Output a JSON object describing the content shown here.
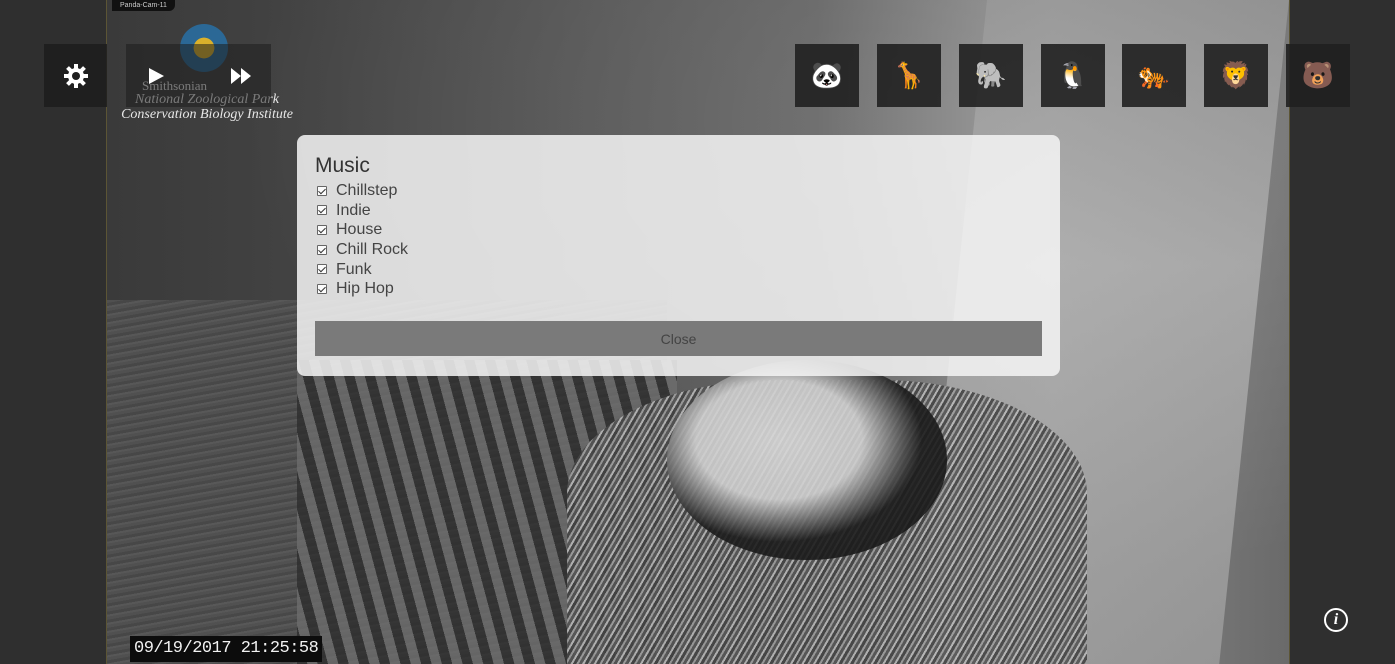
{
  "camera": {
    "label": "Panda-Cam-11",
    "timestamp": "09/19/2017  21:25:58"
  },
  "logo": {
    "line1": "Smithsonian",
    "line2": "National Zoological Park",
    "line3": "Conservation Biology Institute"
  },
  "controls": {
    "settings_icon": "gear-icon",
    "play_icon": "play-icon",
    "skip_icon": "fast-forward-icon"
  },
  "animals": [
    {
      "name": "panda",
      "glyph": "🐼"
    },
    {
      "name": "giraffe",
      "glyph": "🦒"
    },
    {
      "name": "elephant",
      "glyph": "🐘"
    },
    {
      "name": "penguin",
      "glyph": "🐧"
    },
    {
      "name": "tiger",
      "glyph": "🐅"
    },
    {
      "name": "lion",
      "glyph": "🦁"
    },
    {
      "name": "polar-bear",
      "glyph": "🐻"
    }
  ],
  "modal": {
    "title": "Music",
    "options": [
      {
        "label": "Chillstep",
        "checked": true
      },
      {
        "label": "Indie",
        "checked": true
      },
      {
        "label": "House",
        "checked": true
      },
      {
        "label": "Chill Rock",
        "checked": true
      },
      {
        "label": "Funk",
        "checked": true
      },
      {
        "label": "Hip Hop",
        "checked": true
      }
    ],
    "close_label": "Close"
  },
  "info_label": "i"
}
